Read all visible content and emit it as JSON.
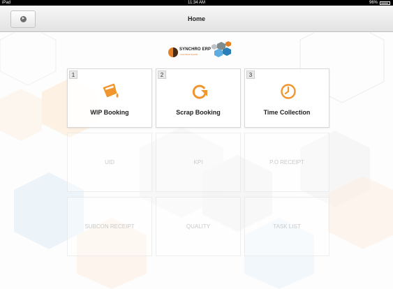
{
  "status_bar": {
    "device": "iPad",
    "time": "11:34 AM",
    "battery": "96%"
  },
  "nav": {
    "title": "Home",
    "back_icon": "back-arrow-icon"
  },
  "logo": {
    "name": "SYNCHRO ERP",
    "tagline": "Cast Metal Specific"
  },
  "colors": {
    "accent": "#f0962e",
    "tile_border": "#d8d8d8",
    "disabled_text": "#c9c9c9"
  },
  "tiles": [
    {
      "number": "1",
      "label": "WIP Booking",
      "icon": "bucket-pour-icon",
      "active": true
    },
    {
      "number": "2",
      "label": "Scrap Booking",
      "icon": "refresh-arrow-icon",
      "active": true
    },
    {
      "number": "3",
      "label": "Time Collection",
      "icon": "clock-icon",
      "active": true
    },
    {
      "label": "UID",
      "active": false
    },
    {
      "label": "KPI",
      "active": false
    },
    {
      "label": "P.O RECEIPT",
      "active": false
    },
    {
      "label": "SUBCON RECEIPT",
      "active": false
    },
    {
      "label": "QUALITY",
      "active": false
    },
    {
      "label": "TASK LIST",
      "active": false
    }
  ]
}
